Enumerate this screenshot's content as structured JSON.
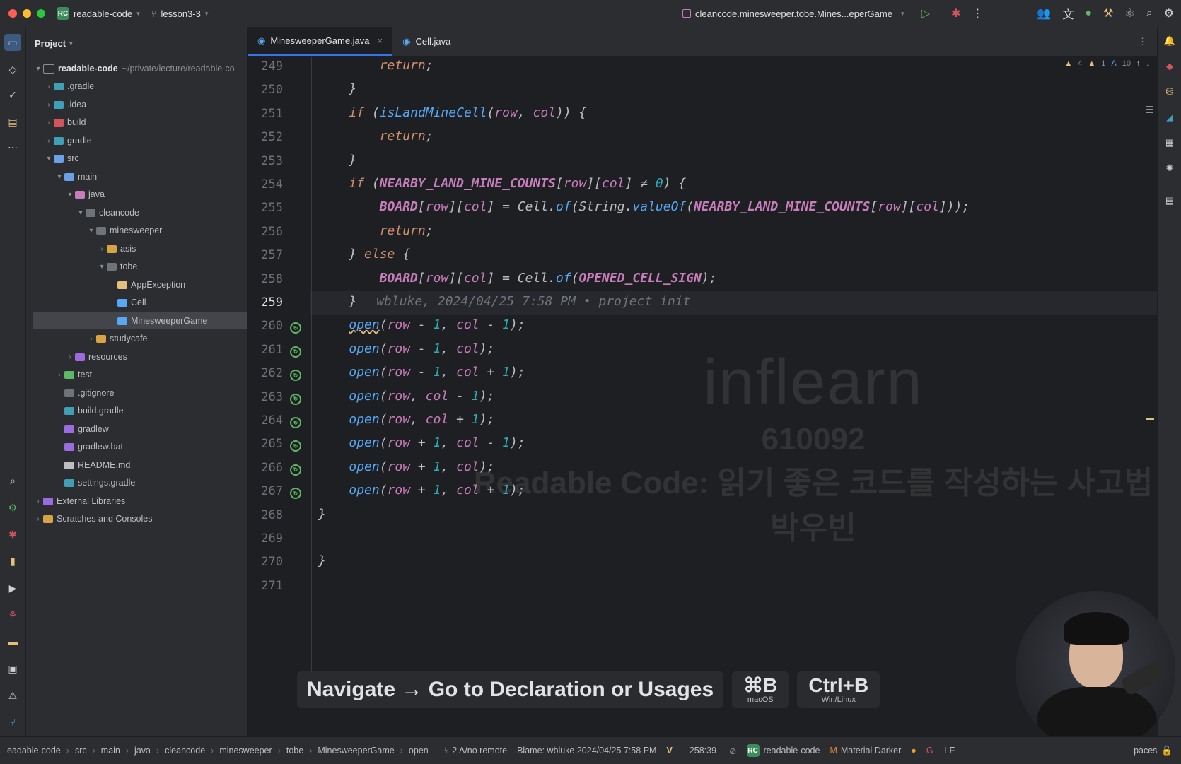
{
  "titlebar": {
    "project_badge": "RC",
    "project_name": "readable-code",
    "branch": "lesson3-3",
    "run_config": "cleancode.minesweeper.tobe.Mines...eperGame"
  },
  "project_panel": {
    "title": "Project",
    "root_name": "readable-code",
    "root_path": "~/private/lecture/readable-co",
    "items": [
      {
        "label": ".gradle",
        "indent": 1,
        "expand": ">",
        "icon_color": "#3f9fb6"
      },
      {
        "label": ".idea",
        "indent": 1,
        "expand": ">",
        "icon_color": "#3f9fb6"
      },
      {
        "label": "build",
        "indent": 1,
        "expand": ">",
        "icon_color": "#d5535d"
      },
      {
        "label": "gradle",
        "indent": 1,
        "expand": ">",
        "icon_color": "#3f9fb6"
      },
      {
        "label": "src",
        "indent": 1,
        "expand": "v",
        "icon_color": "#6aa0e8"
      },
      {
        "label": "main",
        "indent": 2,
        "expand": "v",
        "icon_color": "#6aa0e8"
      },
      {
        "label": "java",
        "indent": 3,
        "expand": "v",
        "icon_color": "#c77dbb"
      },
      {
        "label": "cleancode",
        "indent": 4,
        "expand": "v",
        "icon_color": "#6f737a"
      },
      {
        "label": "minesweeper",
        "indent": 5,
        "expand": "v",
        "icon_color": "#6f737a"
      },
      {
        "label": "asis",
        "indent": 6,
        "expand": ">",
        "icon_color": "#d9a343"
      },
      {
        "label": "tobe",
        "indent": 6,
        "expand": "v",
        "icon_color": "#6f737a"
      },
      {
        "label": "AppException",
        "indent": 7,
        "expand": "",
        "icon_color": "#e5c07b"
      },
      {
        "label": "Cell",
        "indent": 7,
        "expand": "",
        "icon_color": "#56a8f5"
      },
      {
        "label": "MinesweeperGame",
        "indent": 7,
        "expand": "",
        "icon_color": "#56a8f5"
      },
      {
        "label": "studycafe",
        "indent": 5,
        "expand": ">",
        "icon_color": "#d9a343"
      },
      {
        "label": "resources",
        "indent": 3,
        "expand": ">",
        "icon_color": "#9d6be0"
      },
      {
        "label": "test",
        "indent": 2,
        "expand": ">",
        "icon_color": "#5fb865"
      },
      {
        "label": ".gitignore",
        "indent": 2,
        "expand": "",
        "icon_color": "#6f737a"
      },
      {
        "label": "build.gradle",
        "indent": 2,
        "expand": "",
        "icon_color": "#3f9fb6"
      },
      {
        "label": "gradlew",
        "indent": 2,
        "expand": "",
        "icon_color": "#9d6be0"
      },
      {
        "label": "gradlew.bat",
        "indent": 2,
        "expand": "",
        "icon_color": "#9d6be0"
      },
      {
        "label": "README.md",
        "indent": 2,
        "expand": "",
        "icon_color": "#bcbec4"
      },
      {
        "label": "settings.gradle",
        "indent": 2,
        "expand": "",
        "icon_color": "#3f9fb6"
      },
      {
        "label": "External Libraries",
        "indent": 0,
        "expand": ">",
        "icon_color": "#9d6be0"
      },
      {
        "label": "Scratches and Consoles",
        "indent": 0,
        "expand": ">",
        "icon_color": "#d9a343"
      }
    ]
  },
  "tabs": [
    {
      "label": "MinesweeperGame.java",
      "active": true,
      "close": "×"
    },
    {
      "label": "Cell.java",
      "active": false,
      "close": ""
    }
  ],
  "inspections": {
    "warnings": "4",
    "weak_warnings": "1",
    "typos": "10"
  },
  "editor": {
    "lines": [
      {
        "num": "249",
        "text": "        return;"
      },
      {
        "num": "250",
        "text": "    }"
      },
      {
        "num": "251",
        "text": "    if (isLandMineCell(row, col)) {"
      },
      {
        "num": "252",
        "text": "        return;"
      },
      {
        "num": "253",
        "text": "    }"
      },
      {
        "num": "254",
        "text": "    if (NEARBY_LAND_MINE_COUNTS[row][col] ≠ 0) {"
      },
      {
        "num": "255",
        "text": "        BOARD[row][col] = Cell.of(String.valueOf(NEARBY_LAND_MINE_COUNTS[row][col]));"
      },
      {
        "num": "256",
        "text": "        return;"
      },
      {
        "num": "257",
        "text": "    } else {"
      },
      {
        "num": "258",
        "text": "        BOARD[row][col] = Cell.of(OPENED_CELL_SIGN);"
      },
      {
        "num": "259",
        "text": "    }"
      },
      {
        "num": "260",
        "text": "    open(row - 1, col - 1);"
      },
      {
        "num": "261",
        "text": "    open(row - 1, col);"
      },
      {
        "num": "262",
        "text": "    open(row - 1, col + 1);"
      },
      {
        "num": "263",
        "text": "    open(row, col - 1);"
      },
      {
        "num": "264",
        "text": "    open(row, col + 1);"
      },
      {
        "num": "265",
        "text": "    open(row + 1, col - 1);"
      },
      {
        "num": "266",
        "text": "    open(row + 1, col);"
      },
      {
        "num": "267",
        "text": "    open(row + 1, col + 1);"
      },
      {
        "num": "268",
        "text": "}"
      },
      {
        "num": "269",
        "text": ""
      },
      {
        "num": "270",
        "text": "}"
      },
      {
        "num": "271",
        "text": ""
      }
    ],
    "blame_inline": "wbluke, 2024/04/25 7:58 PM • project init"
  },
  "watermark": {
    "logo": "inflearn",
    "code": "610092",
    "course": "Readable Code: 읽기 좋은 코드를 작성하는 사고법",
    "author": "박우빈"
  },
  "shortcut_overlay": {
    "action": "Navigate → Go to Declaration or Usages",
    "mac_key": "⌘B",
    "mac_label": "macOS",
    "win_key": "Ctrl+B",
    "win_label": "Win/Linux"
  },
  "statusbar": {
    "breadcrumbs": [
      "eadable-code",
      "src",
      "main",
      "java",
      "cleancode",
      "minesweeper",
      "tobe",
      "MinesweeperGame",
      "open"
    ],
    "vcs": "2 Δ/no remote",
    "blame": "Blame: wbluke 2024/04/25 7:58 PM",
    "position": "258:39",
    "project": "readable-code",
    "theme": "Material Darker",
    "line_sep": "LF",
    "indent": "paces"
  },
  "colors": {
    "accent": "#3574f0",
    "bg": "#1e1f22",
    "panel": "#2b2d30",
    "keyword": "#cf8e6d",
    "function": "#56a8f5",
    "field": "#c77dbb",
    "number": "#2aacb8",
    "changed": "#e5c07b"
  }
}
